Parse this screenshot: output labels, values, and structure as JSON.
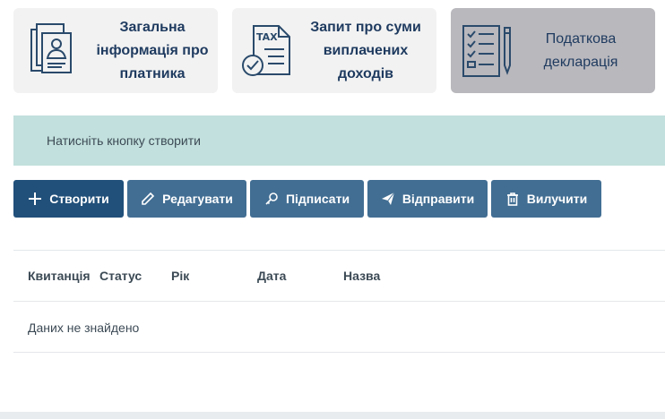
{
  "cards": [
    {
      "label_lines": [
        "Загальна",
        "інформація про",
        "платника"
      ],
      "icon": "profile-document-icon"
    },
    {
      "label_lines": [
        "Запит про суми",
        "виплачених",
        "доходів"
      ],
      "icon": "tax-document-icon"
    },
    {
      "label_lines": [
        "Податкова",
        "декларація"
      ],
      "icon": "checklist-clipboard-icon",
      "active": true
    }
  ],
  "info_message": "Натисніть кнопку створити",
  "toolbar": {
    "create": "Створити",
    "edit": "Редагувати",
    "sign": "Підписати",
    "send": "Відправити",
    "delete": "Вилучити"
  },
  "table": {
    "columns": [
      "Квитанція",
      "Статус",
      "Рік",
      "Дата",
      "Назва"
    ],
    "empty_text": "Даних не знайдено"
  },
  "colors": {
    "primary_button": "#21507a",
    "secondary_button": "#426e93",
    "info_bg": "#c2e0dd",
    "active_card": "#b9b8bd"
  }
}
